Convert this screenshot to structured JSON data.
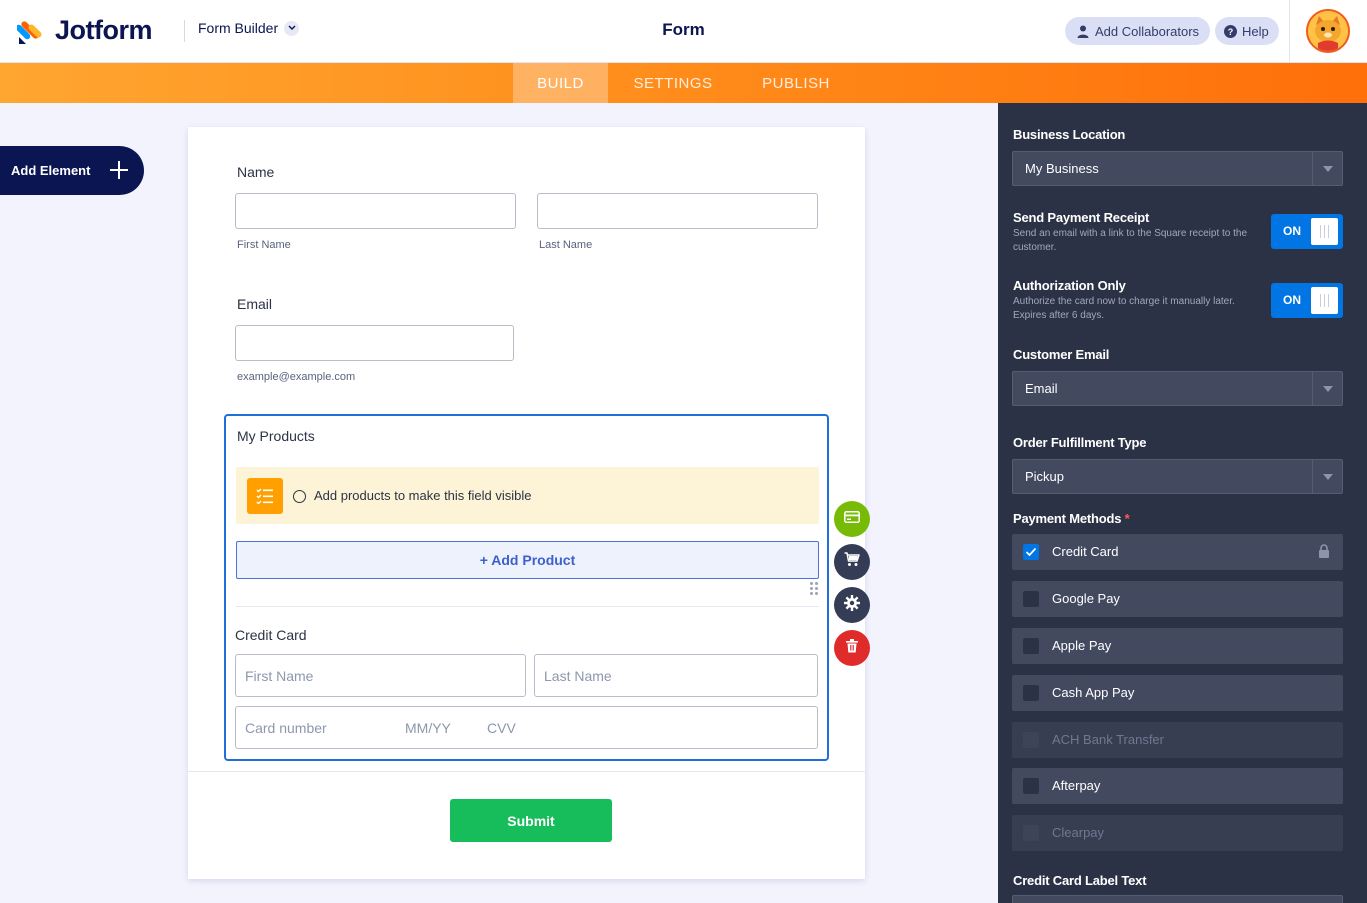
{
  "header": {
    "logo_text": "Jotform",
    "builder_label": "Form Builder",
    "form_title": "Form",
    "add_collaborators": "Add Collaborators",
    "help": "Help"
  },
  "nav": {
    "tabs": [
      {
        "label": "BUILD",
        "active": true
      },
      {
        "label": "SETTINGS",
        "active": false
      },
      {
        "label": "PUBLISH",
        "active": false
      }
    ]
  },
  "sidebar": {
    "add_element": "Add Element"
  },
  "form": {
    "name": {
      "label": "Name",
      "first_sublabel": "First Name",
      "last_sublabel": "Last Name"
    },
    "email": {
      "label": "Email",
      "sublabel": "example@example.com"
    },
    "products": {
      "label": "My Products",
      "notice": "Add products to make this field visible",
      "add_product": "+ Add Product"
    },
    "credit_card": {
      "label": "Credit Card",
      "first_name_placeholder": "First Name",
      "last_name_placeholder": "Last Name",
      "card_number_placeholder": "Card number",
      "expiry_placeholder": "MM/YY",
      "cvv_placeholder": "CVV"
    },
    "submit": "Submit"
  },
  "panel": {
    "business_location": {
      "label": "Business Location",
      "value": "My Business"
    },
    "send_receipt": {
      "label": "Send Payment Receipt",
      "desc": "Send an email with a link to the Square receipt to the customer.",
      "state": "ON"
    },
    "auth_only": {
      "label": "Authorization Only",
      "desc": "Authorize the card now to charge it manually later. Expires after 6 days.",
      "state": "ON"
    },
    "customer_email": {
      "label": "Customer Email",
      "value": "Email"
    },
    "fulfillment": {
      "label": "Order Fulfillment Type",
      "value": "Pickup"
    },
    "payment_methods": {
      "label": "Payment Methods",
      "required_mark": "*",
      "items": [
        {
          "label": "Credit Card",
          "checked": true,
          "disabled": false,
          "locked": true
        },
        {
          "label": "Google Pay",
          "checked": false,
          "disabled": false
        },
        {
          "label": "Apple Pay",
          "checked": false,
          "disabled": false
        },
        {
          "label": "Cash App Pay",
          "checked": false,
          "disabled": false
        },
        {
          "label": "ACH Bank Transfer",
          "checked": false,
          "disabled": true
        },
        {
          "label": "Afterpay",
          "checked": false,
          "disabled": false
        },
        {
          "label": "Clearpay",
          "checked": false,
          "disabled": true
        }
      ]
    },
    "cc_label_text": {
      "label": "Credit Card Label Text"
    }
  },
  "colors": {
    "brand_navy": "#0a1551",
    "accent_orange": "#ff8c1a",
    "selection_blue": "#1f6fd8",
    "submit_green": "#18bd5b",
    "panel_bg": "#2c3245",
    "toggle_blue": "#0075e3"
  },
  "icons": {
    "logo": "jotform-logo-icon",
    "collaborators": "user-icon",
    "help": "question-icon",
    "notice": "list-icon",
    "payment": "credit-card-icon",
    "cart": "cart-icon",
    "settings": "gear-icon",
    "delete": "trash-icon",
    "lock": "lock-icon"
  }
}
